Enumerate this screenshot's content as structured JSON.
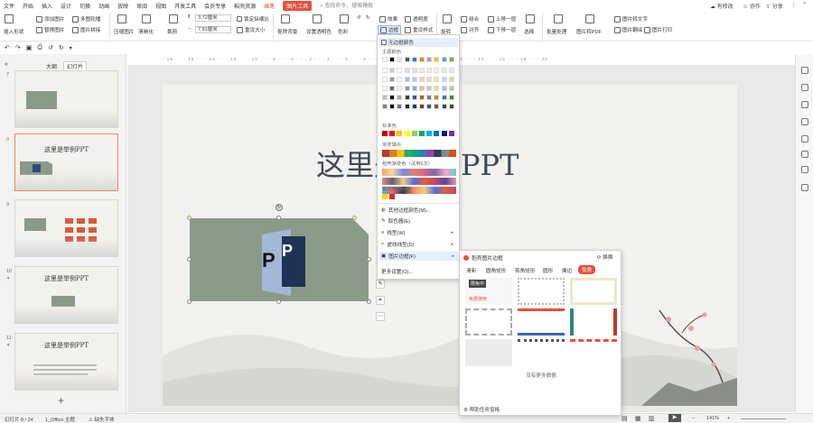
{
  "menu": {
    "file": "文件",
    "items": [
      "开始",
      "插入",
      "设计",
      "切换",
      "动画",
      "放映",
      "审阅",
      "视图",
      "开发工具",
      "会员专享",
      "稻壳资源"
    ],
    "tab_drawing": "画笔",
    "tab_picture_tools": "图片工具",
    "search": "查找命令、搜索模板",
    "unsaved": "有修改",
    "collab": "协作",
    "share": "分享"
  },
  "ribbon": {
    "insert_shape": "插入形状",
    "add_picture": "添加图片",
    "replace_picture": "替换图片",
    "multi_combine": "多图轮播",
    "picture_stitch": "图片拼接",
    "compress": "压缩图片",
    "clarity": "清晰化",
    "crop": "裁剪",
    "width_value": "3.72厘米",
    "height_value": "7.91厘米",
    "lock_ratio": "锁定纵横比",
    "reset_size": "重设大小",
    "cutout": "抠除背景",
    "set_transparent": "设置透明色",
    "color": "色彩",
    "effects": "效果",
    "transparency": "透明度",
    "border": "边框",
    "reset_style": "重设样式",
    "combine": "组合",
    "rotate": "旋转",
    "align": "对齐",
    "bring_forward": "上移一层",
    "send_backward": "下移一层",
    "select": "选择",
    "batch": "批量处理",
    "to_pdf": "图片转PDF",
    "translate": "图片翻译",
    "to_text": "图片转文字",
    "print": "图片打印"
  },
  "left_panel": {
    "tab_outline": "大纲",
    "tab_slides": "幻灯片",
    "add_icon": "+",
    "thumbs": [
      {
        "num": "7",
        "title": ""
      },
      {
        "num": "8",
        "title": "这里是举例PPT"
      },
      {
        "num": "9",
        "title": ""
      },
      {
        "num": "10",
        "title": "这里是举例PPT"
      },
      {
        "num": "11",
        "title": "这里是举例PPT"
      }
    ]
  },
  "slide": {
    "title": "这里是举例PPT"
  },
  "dropdown": {
    "no_border": "无边框颜色",
    "theme_colors": "主题颜色",
    "standard_colors": "标准色",
    "gradient_fill": "渐变填充",
    "docer_gradient": "稻壳渐变色（试用6次）",
    "recent_colors": "最近使用颜色",
    "more_colors": "其他边框颜色(M)...",
    "eyedropper": "取色器(E)",
    "line_weight": "线型(W)",
    "dash_type": "虚线线型(D)",
    "picture_border": "图片边框(F)",
    "more_settings": "更多设置(O)...",
    "theme_palette": [
      "#ffffff",
      "#000000",
      "#e7e6e6",
      "#44546a",
      "#4472c4",
      "#ed7d31",
      "#a5a5a5",
      "#ffc000",
      "#5b9bd5",
      "#70ad47"
    ],
    "standard_palette": [
      "#c00000",
      "#ff0000",
      "#ffc000",
      "#ffff00",
      "#92d050",
      "#00b050",
      "#00b0f0",
      "#0070c0",
      "#002060",
      "#7030a0"
    ],
    "recent_palette": [
      "#ffd200",
      "#e4261c"
    ]
  },
  "submenu": {
    "title": "稻壳图片边框",
    "change": "换换",
    "tabs": [
      "清新",
      "圆角矩形",
      "剪角矩形",
      "圆形",
      "撕边",
      "免费"
    ],
    "tooltip": "限免中",
    "free_label": "免费使用",
    "no_more": "没有更多数据",
    "help": "帮助任务窗格"
  },
  "status": {
    "slide_pos": "幻灯片 8 / 24",
    "theme": "1_Office 主题",
    "missing_font": "缺失字体",
    "zoom": "141%"
  },
  "colors": {
    "accent": "#e94f3c",
    "picture_bg": "#8a9a88",
    "ppt_blue": "#a3b8d6"
  }
}
